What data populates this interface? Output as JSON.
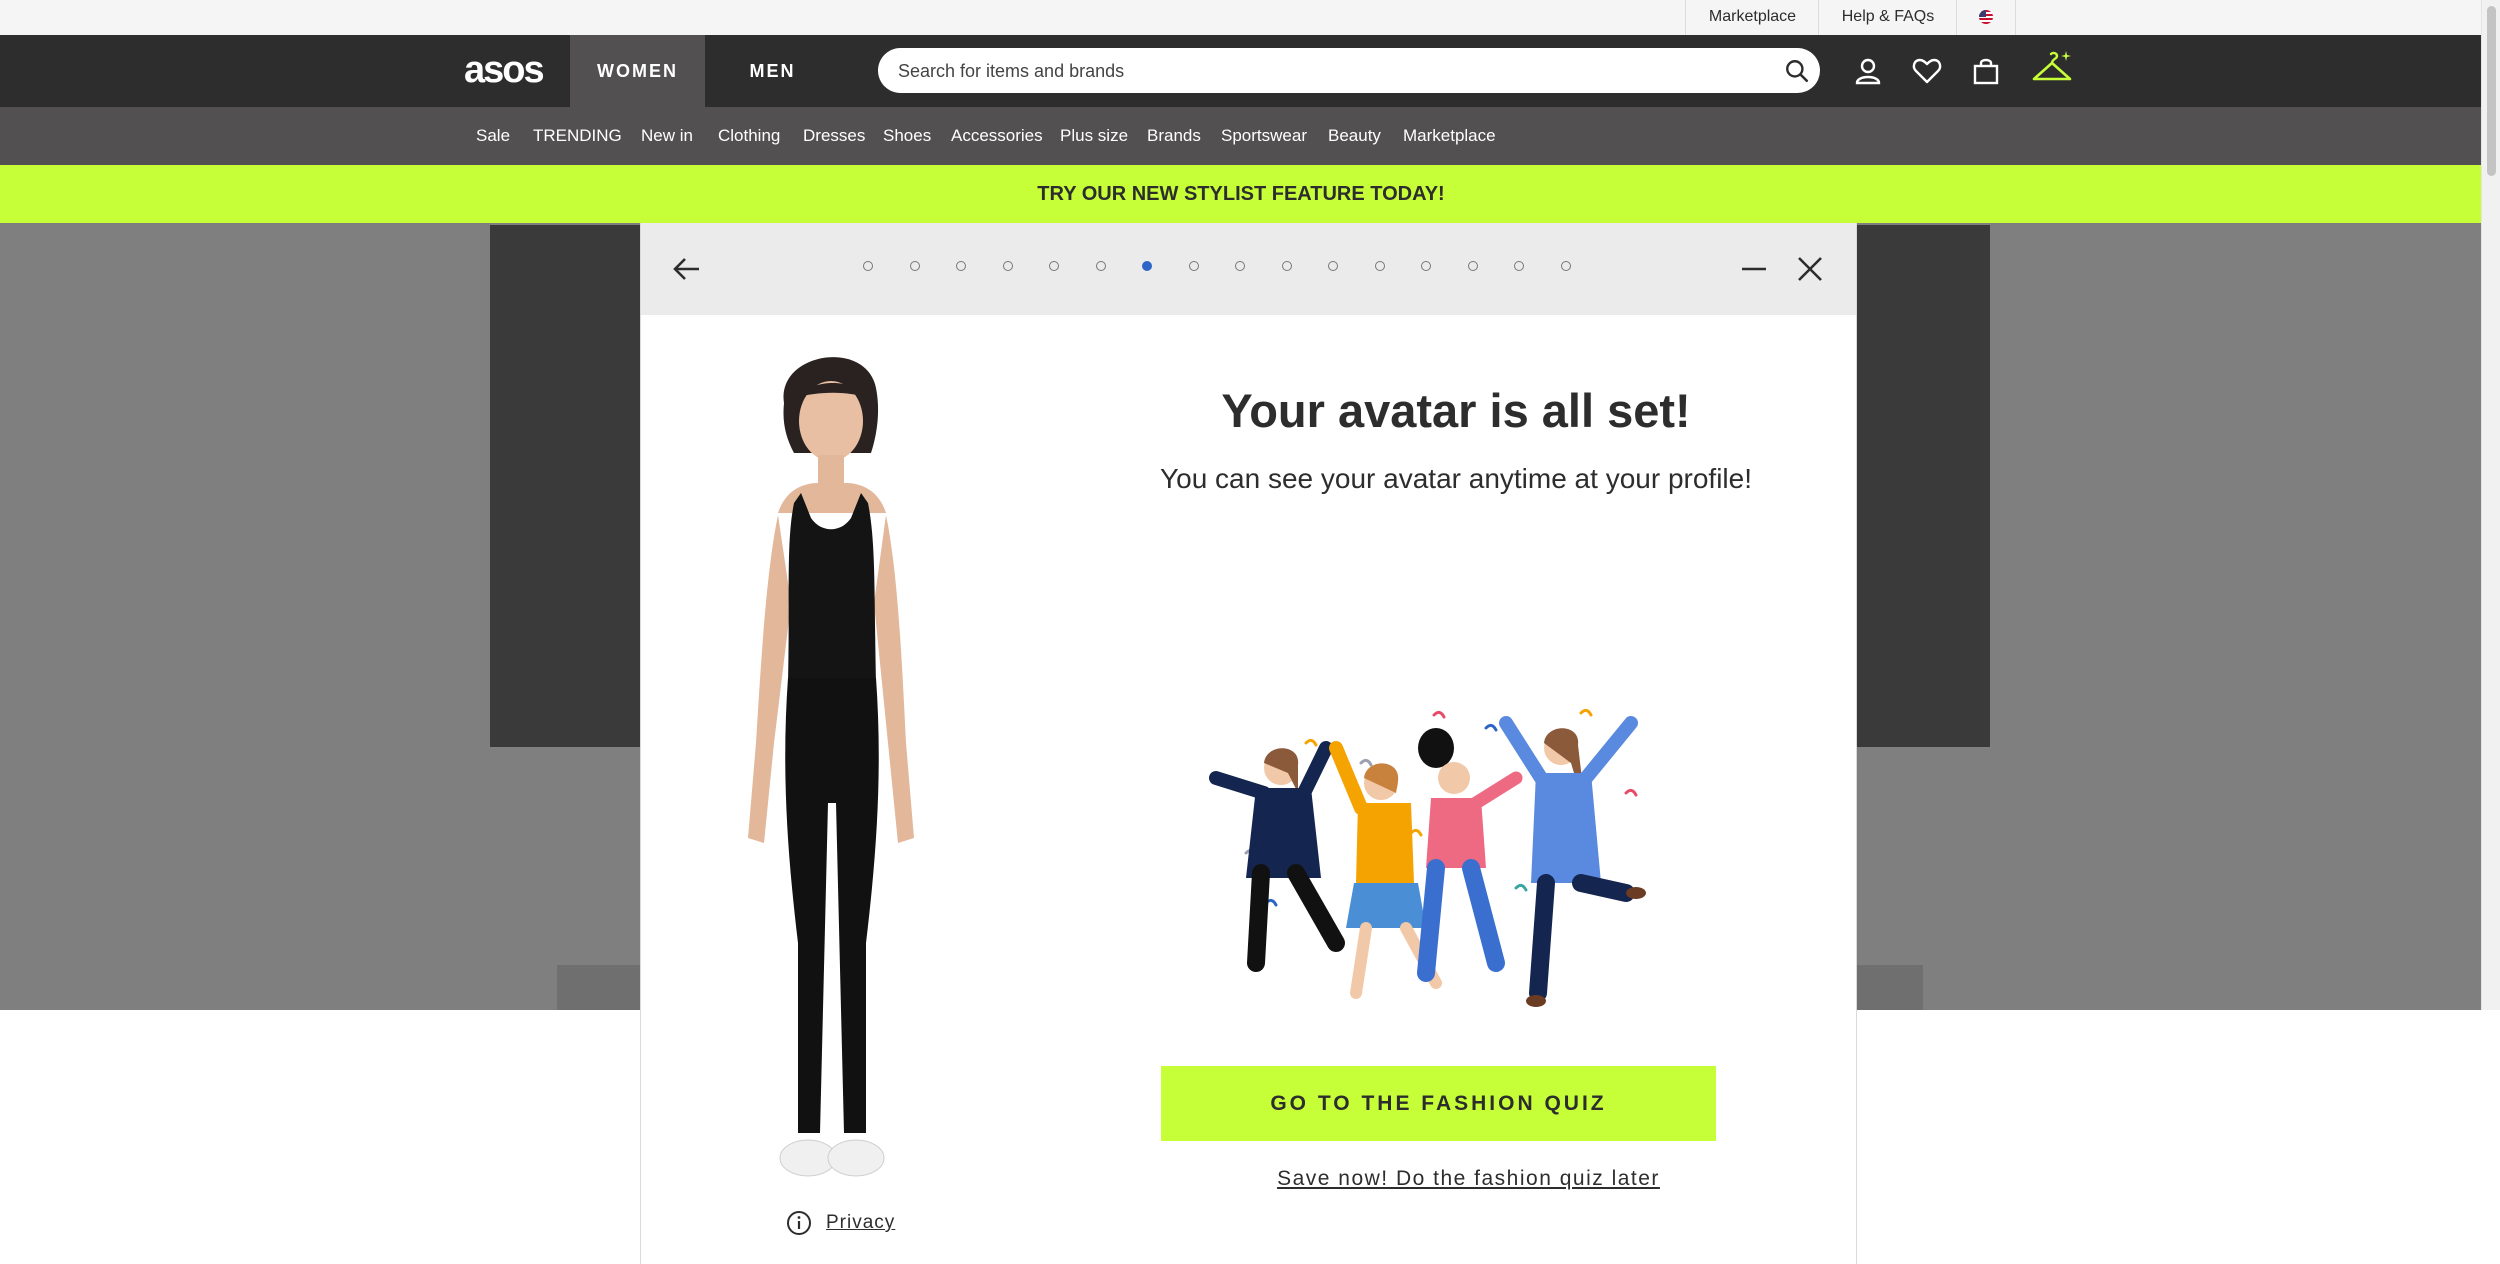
{
  "utility_bar": {
    "marketplace": "Marketplace",
    "help": "Help & FAQs",
    "flag_icon": "us-flag-icon"
  },
  "header": {
    "logo": "asos",
    "tabs": [
      "WOMEN",
      "MEN"
    ],
    "active_tab": "WOMEN",
    "search_placeholder": "Search for items and brands",
    "icons": [
      "account-icon",
      "heart-icon",
      "bag-icon",
      "hanger-stylist-icon"
    ]
  },
  "sub_nav": [
    "Sale",
    "TRENDING",
    "New in",
    "Clothing",
    "Dresses",
    "Shoes",
    "Accessories",
    "Plus size",
    "Brands",
    "Sportswear",
    "Beauty",
    "Marketplace"
  ],
  "promo": "TRY OUR NEW STYLIST FEATURE TODAY!",
  "modal": {
    "progress": {
      "total_steps": 16,
      "current_step": 7
    },
    "title": "Your avatar is all set!",
    "subtitle": "You can see your avatar anytime at your profile!",
    "primary_button": "GO TO THE FASHION QUIZ",
    "secondary_link": "Save now! Do the fashion quiz later",
    "privacy_link": "Privacy"
  },
  "colors": {
    "dark": "#2d2d2d",
    "nav_secondary": "#525050",
    "accent_lime": "#c6ff37",
    "active_dot": "#2d64c8"
  }
}
